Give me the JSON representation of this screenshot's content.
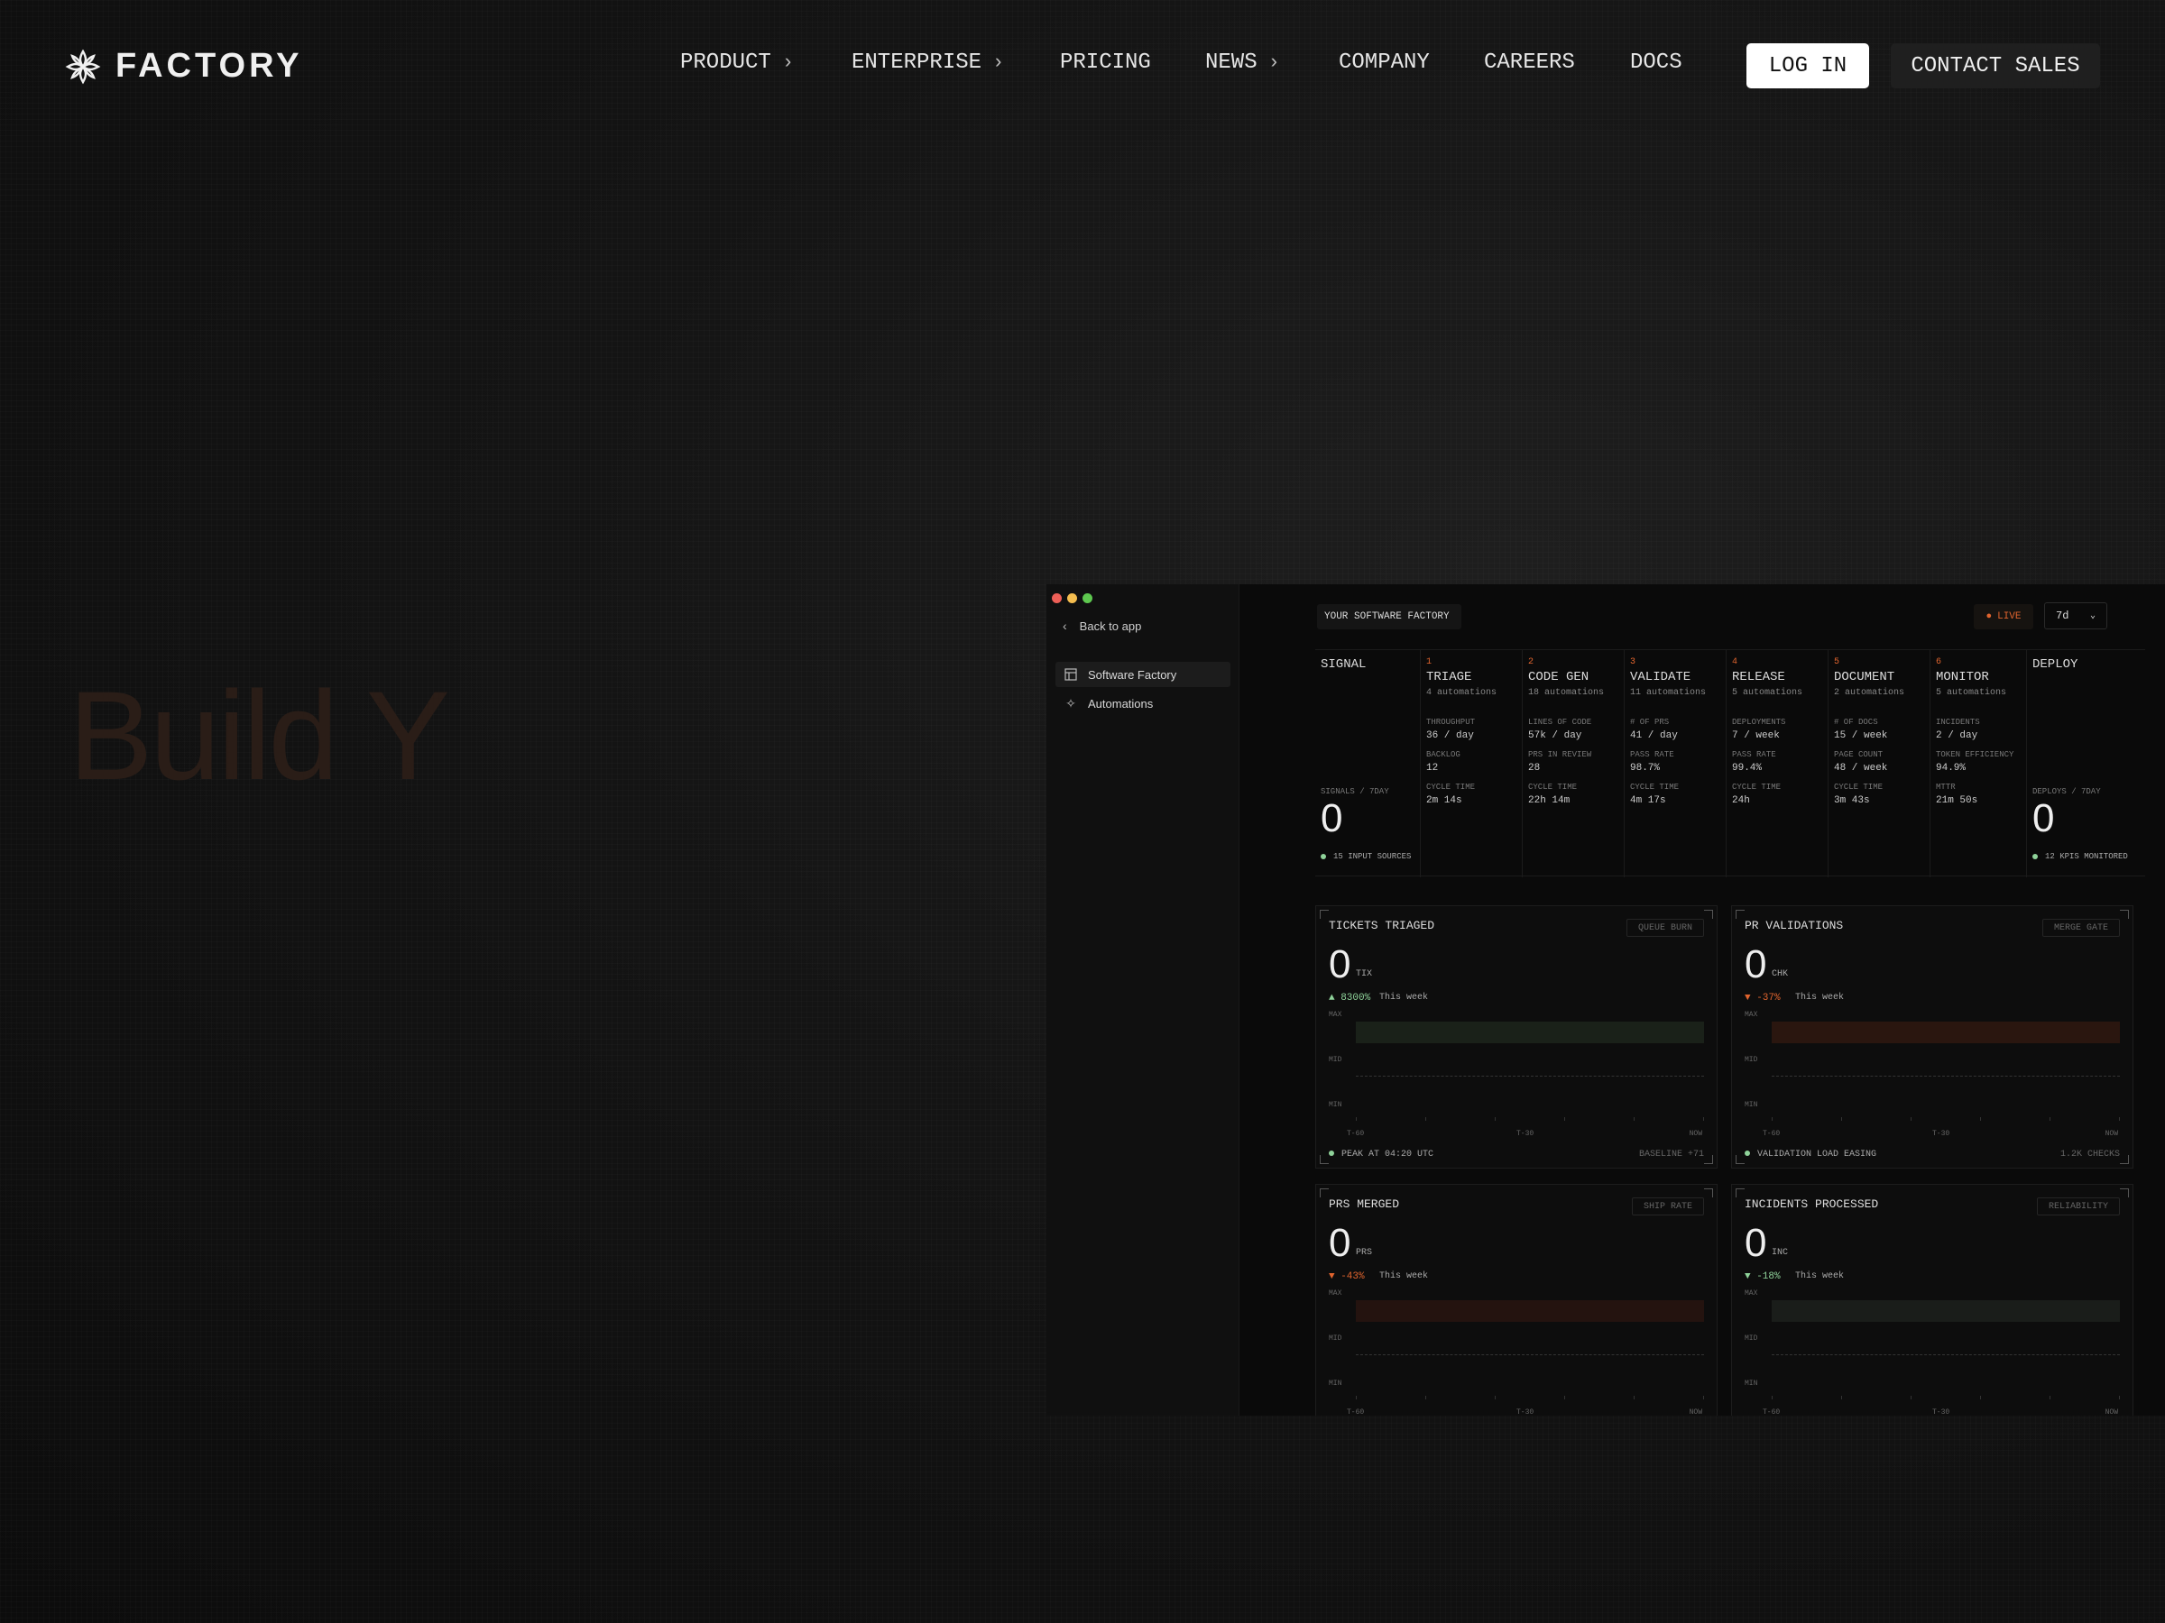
{
  "brand": {
    "name": "FACTORY"
  },
  "nav": {
    "items": [
      {
        "label": "PRODUCT",
        "has_chevron": true
      },
      {
        "label": "ENTERPRISE",
        "has_chevron": true
      },
      {
        "label": "PRICING",
        "has_chevron": false
      },
      {
        "label": "NEWS",
        "has_chevron": true
      },
      {
        "label": "COMPANY",
        "has_chevron": false
      },
      {
        "label": "CAREERS",
        "has_chevron": false
      },
      {
        "label": "DOCS",
        "has_chevron": false
      }
    ],
    "login_label": "LOG IN",
    "sales_label": "CONTACT SALES"
  },
  "hero": {
    "headline": "Build Y"
  },
  "app": {
    "back_label": "Back to app",
    "sidebar": [
      {
        "label": "Software Factory",
        "icon": "layout-icon",
        "active": true
      },
      {
        "label": "Automations",
        "icon": "sparkle-icon",
        "active": false
      }
    ],
    "title": "YOUR SOFTWARE FACTORY",
    "live_label": "LIVE",
    "range": "7d",
    "signal": {
      "name": "SIGNAL",
      "metric_label": "SIGNALS / 7DAY",
      "value": "0",
      "footer": "15 INPUT SOURCES"
    },
    "deploy": {
      "name": "DEPLOY",
      "metric_label": "DEPLOYS / 7DAY",
      "value": "0",
      "footer": "12 KPIS MONITORED"
    },
    "stages": [
      {
        "num": "1",
        "name": "TRIAGE",
        "automations": "4 automations",
        "metrics": [
          [
            "THROUGHPUT",
            "36 / day"
          ],
          [
            "BACKLOG",
            "12"
          ],
          [
            "CYCLE TIME",
            "2m 14s"
          ]
        ]
      },
      {
        "num": "2",
        "name": "CODE GEN",
        "automations": "18 automations",
        "metrics": [
          [
            "LINES OF CODE",
            "57k / day"
          ],
          [
            "PRS IN REVIEW",
            "28"
          ],
          [
            "CYCLE TIME",
            "22h 14m"
          ]
        ]
      },
      {
        "num": "3",
        "name": "VALIDATE",
        "automations": "11 automations",
        "metrics": [
          [
            "# OF PRS",
            "41 / day"
          ],
          [
            "PASS RATE",
            "98.7%"
          ],
          [
            "CYCLE TIME",
            "4m 17s"
          ]
        ]
      },
      {
        "num": "4",
        "name": "RELEASE",
        "automations": "5 automations",
        "metrics": [
          [
            "DEPLOYMENTS",
            "7 / week"
          ],
          [
            "PASS RATE",
            "99.4%"
          ],
          [
            "CYCLE TIME",
            "24h"
          ]
        ]
      },
      {
        "num": "5",
        "name": "DOCUMENT",
        "automations": "2 automations",
        "metrics": [
          [
            "# OF DOCS",
            "15 / week"
          ],
          [
            "PAGE COUNT",
            "48 / week"
          ],
          [
            "CYCLE TIME",
            "3m 43s"
          ]
        ]
      },
      {
        "num": "6",
        "name": "MONITOR",
        "automations": "5 automations",
        "metrics": [
          [
            "INCIDENTS",
            "2 / day"
          ],
          [
            "TOKEN EFFICIENCY",
            "94.9%"
          ],
          [
            "MTTR",
            "21m 50s"
          ]
        ]
      }
    ],
    "cards": [
      {
        "title": "TICKETS TRIAGED",
        "tag": "QUEUE BURN",
        "value": "0",
        "unit": "TIX",
        "delta": "▲ 8300%",
        "delta_color": "#8fd39a",
        "week": "This week",
        "band_color": "#1a2119",
        "footer": "PEAK AT 04:20 UTC",
        "footer_right": "BASELINE +71"
      },
      {
        "title": "PR VALIDATIONS",
        "tag": "MERGE GATE",
        "value": "0",
        "unit": "CHK",
        "delta": "▼ -37%",
        "delta_color": "#e0642e",
        "week": "This week",
        "band_color": "#2a160f",
        "footer": "VALIDATION LOAD EASING",
        "footer_right": "1.2K CHECKS"
      },
      {
        "title": "PRS MERGED",
        "tag": "SHIP RATE",
        "value": "0",
        "unit": "PRS",
        "delta": "▼ -43%",
        "delta_color": "#e0642e",
        "week": "This week",
        "band_color": "#24130f",
        "footer": "",
        "footer_right": ""
      },
      {
        "title": "INCIDENTS PROCESSED",
        "tag": "RELIABILITY",
        "value": "0",
        "unit": "INC",
        "delta": "▼ -18%",
        "delta_color": "#8fd39a",
        "week": "This week",
        "band_color": "#1a1d1a",
        "footer": "",
        "footer_right": ""
      }
    ],
    "axis": {
      "y": [
        "MAX",
        "MID",
        "MIN"
      ],
      "x": [
        "T-60",
        "T-30",
        "NOW"
      ]
    }
  },
  "colors": {
    "accent": "#e0642e",
    "positive": "#8fd39a",
    "bg": "#0f0f0f"
  }
}
